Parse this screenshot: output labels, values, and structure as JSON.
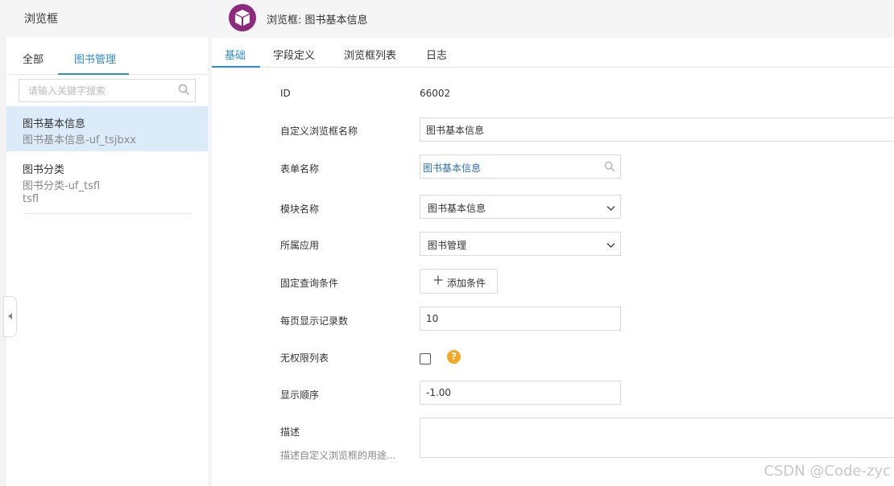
{
  "left": {
    "title": "浏览框",
    "tabs": {
      "all": "全部",
      "mgmt": "图书管理"
    },
    "search_placeholder": "请输入关键字搜索",
    "items": [
      {
        "title": "图书基本信息",
        "sub": "图书基本信息-uf_tsjbxx"
      },
      {
        "title": "图书分类",
        "sub": "图书分类-uf_tsfl",
        "sub2": "tsfl"
      }
    ]
  },
  "header": {
    "title": "浏览框: 图书基本信息"
  },
  "tabs": [
    "基础",
    "字段定义",
    "浏览框列表",
    "日志"
  ],
  "form": {
    "id_label": "ID",
    "id_value": "66002",
    "name_label": "自定义浏览框名称",
    "name_value": "图书基本信息",
    "form_name_label": "表单名称",
    "form_name_value": "图书基本信息",
    "module_label": "模块名称",
    "module_value": "图书基本信息",
    "app_label": "所属应用",
    "app_value": "图书管理",
    "fixed_query_label": "固定查询条件",
    "add_condition_label": "添加条件",
    "page_size_label": "每页显示记录数",
    "page_size_value": "10",
    "no_perm_label": "无权限列表",
    "order_label": "显示顺序",
    "order_value": "-1.00",
    "desc_label": "描述",
    "desc_hint": "描述自定义浏览框的用途..."
  },
  "watermark": "CSDN @Code-zyc",
  "colors": {
    "accent": "#2d8cd6",
    "logo": "#8e2a7e",
    "help": "#f5a623"
  }
}
